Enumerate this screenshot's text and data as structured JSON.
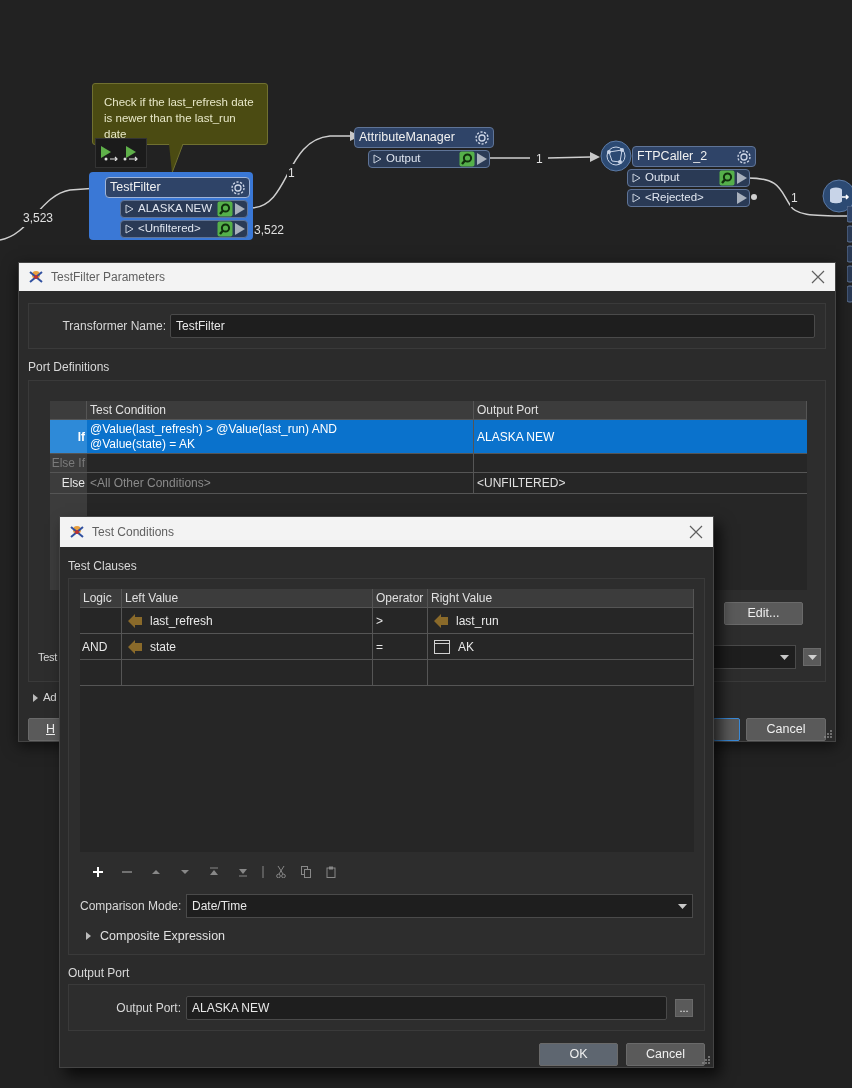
{
  "canvas": {
    "annotation": "Check if the last_refresh date is newer than the last_run date",
    "nodes": [
      {
        "title": "TestFilter",
        "selected": true,
        "ports": [
          {
            "label": "ALASKA NEW",
            "inspect": true
          },
          {
            "label": "<Unfiltered>",
            "inspect": true
          }
        ]
      },
      {
        "title": "AttributeManager",
        "selected": false,
        "ports": [
          {
            "label": "Output",
            "inspect": true
          }
        ]
      },
      {
        "title": "FTPCaller_2",
        "selected": false,
        "ports": [
          {
            "label": "Output",
            "inspect": true
          },
          {
            "label": "<Rejected>",
            "inspect": false
          }
        ]
      }
    ],
    "links": [
      {
        "count": "3,523"
      },
      {
        "count": "1"
      },
      {
        "count": "3,522"
      },
      {
        "count": "1"
      },
      {
        "count": "1"
      }
    ]
  },
  "parameters": {
    "title": "TestFilter Parameters",
    "transformer_name_label": "Transformer Name:",
    "transformer_name": "TestFilter",
    "port_definitions": "Port Definitions",
    "columns": [
      "Test Condition",
      "Output Port"
    ],
    "rows": [
      {
        "logic": "If",
        "condition": "@Value(last_refresh) > @Value(last_run) AND\n@Value(state) = AK",
        "output": "ALASKA NEW",
        "selected": true,
        "disabled": false
      },
      {
        "logic": "Else If",
        "condition": "",
        "output": "",
        "selected": false,
        "disabled": true
      },
      {
        "logic": "Else",
        "condition": "<All Other Conditions>",
        "output": "<UNFILTERED>",
        "selected": false,
        "disabled": false
      }
    ],
    "edit_button": "Edit...",
    "test_label": "Test",
    "advanced_label": "Ad",
    "help_button": "H",
    "cancel_button": "Cancel"
  },
  "conditions": {
    "title": "Test Conditions",
    "clauses_label": "Test Clauses",
    "columns": [
      "Logic",
      "Left Value",
      "Operator",
      "Right Value"
    ],
    "rows": [
      {
        "logic": "",
        "left": {
          "text": "last_refresh",
          "kind": "attribute"
        },
        "operator": ">",
        "right": {
          "text": "last_run",
          "kind": "attribute"
        }
      },
      {
        "logic": "AND",
        "left": {
          "text": "state",
          "kind": "attribute"
        },
        "operator": "=",
        "right": {
          "text": "AK",
          "kind": "constant"
        }
      }
    ],
    "comparison_label": "Comparison Mode:",
    "comparison_mode": "Date/Time",
    "composite": {
      "label": "Composite Expression",
      "expanded": false
    },
    "output_section": "Output Port",
    "output_label": "Output Port:",
    "output_value": "ALASKA NEW",
    "browse_button": "...",
    "buttons": [
      {
        "label": "OK",
        "default": true
      },
      {
        "label": "Cancel",
        "default": false
      }
    ]
  }
}
